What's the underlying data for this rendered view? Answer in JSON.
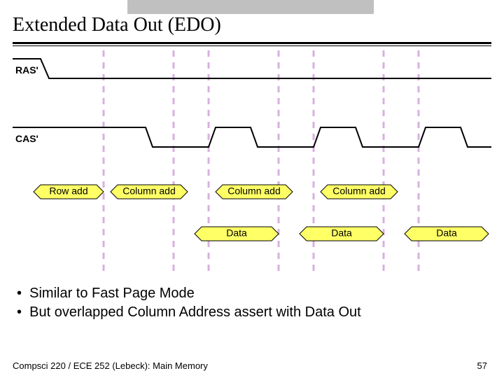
{
  "title": "Extended Data Out (EDO)",
  "signals": {
    "ras": "RAS'",
    "cas": "CAS'"
  },
  "address_labels": {
    "row": "Row add",
    "col1": "Column add",
    "col2": "Column add",
    "col3": "Column add"
  },
  "data_labels": {
    "d1": "Data",
    "d2": "Data",
    "d3": "Data"
  },
  "bullets": [
    "Similar to Fast Page Mode",
    "But overlapped Column Address assert with Data Out"
  ],
  "footer": {
    "left": "Compsci 220 / ECE 252 (Lebeck): Main Memory",
    "page": "57"
  },
  "chart_data": {
    "type": "timing-diagram",
    "title": "Extended Data Out (EDO)",
    "signals": [
      {
        "name": "RAS'",
        "points": [
          {
            "t": 0,
            "level": "high"
          },
          {
            "t": 40,
            "level": "low"
          },
          {
            "t": 684,
            "level": "low"
          }
        ]
      },
      {
        "name": "CAS'",
        "points": [
          {
            "t": 0,
            "level": "high"
          },
          {
            "t": 190,
            "level": "low"
          },
          {
            "t": 280,
            "level": "high"
          },
          {
            "t": 340,
            "level": "low"
          },
          {
            "t": 430,
            "level": "high"
          },
          {
            "t": 490,
            "level": "low"
          },
          {
            "t": 580,
            "level": "high"
          },
          {
            "t": 640,
            "level": "low"
          }
        ]
      }
    ],
    "address_bus": [
      {
        "t_start": 30,
        "t_end": 130,
        "value": "Row add"
      },
      {
        "t_start": 140,
        "t_end": 250,
        "value": "Column add"
      },
      {
        "t_start": 290,
        "t_end": 400,
        "value": "Column add"
      },
      {
        "t_start": 440,
        "t_end": 550,
        "value": "Column add"
      }
    ],
    "data_bus": [
      {
        "t_start": 260,
        "t_end": 380,
        "value": "Data"
      },
      {
        "t_start": 410,
        "t_end": 530,
        "value": "Data"
      },
      {
        "t_start": 560,
        "t_end": 680,
        "value": "Data"
      }
    ],
    "time_markers": [
      130,
      230,
      280,
      380,
      430,
      530,
      580
    ]
  }
}
